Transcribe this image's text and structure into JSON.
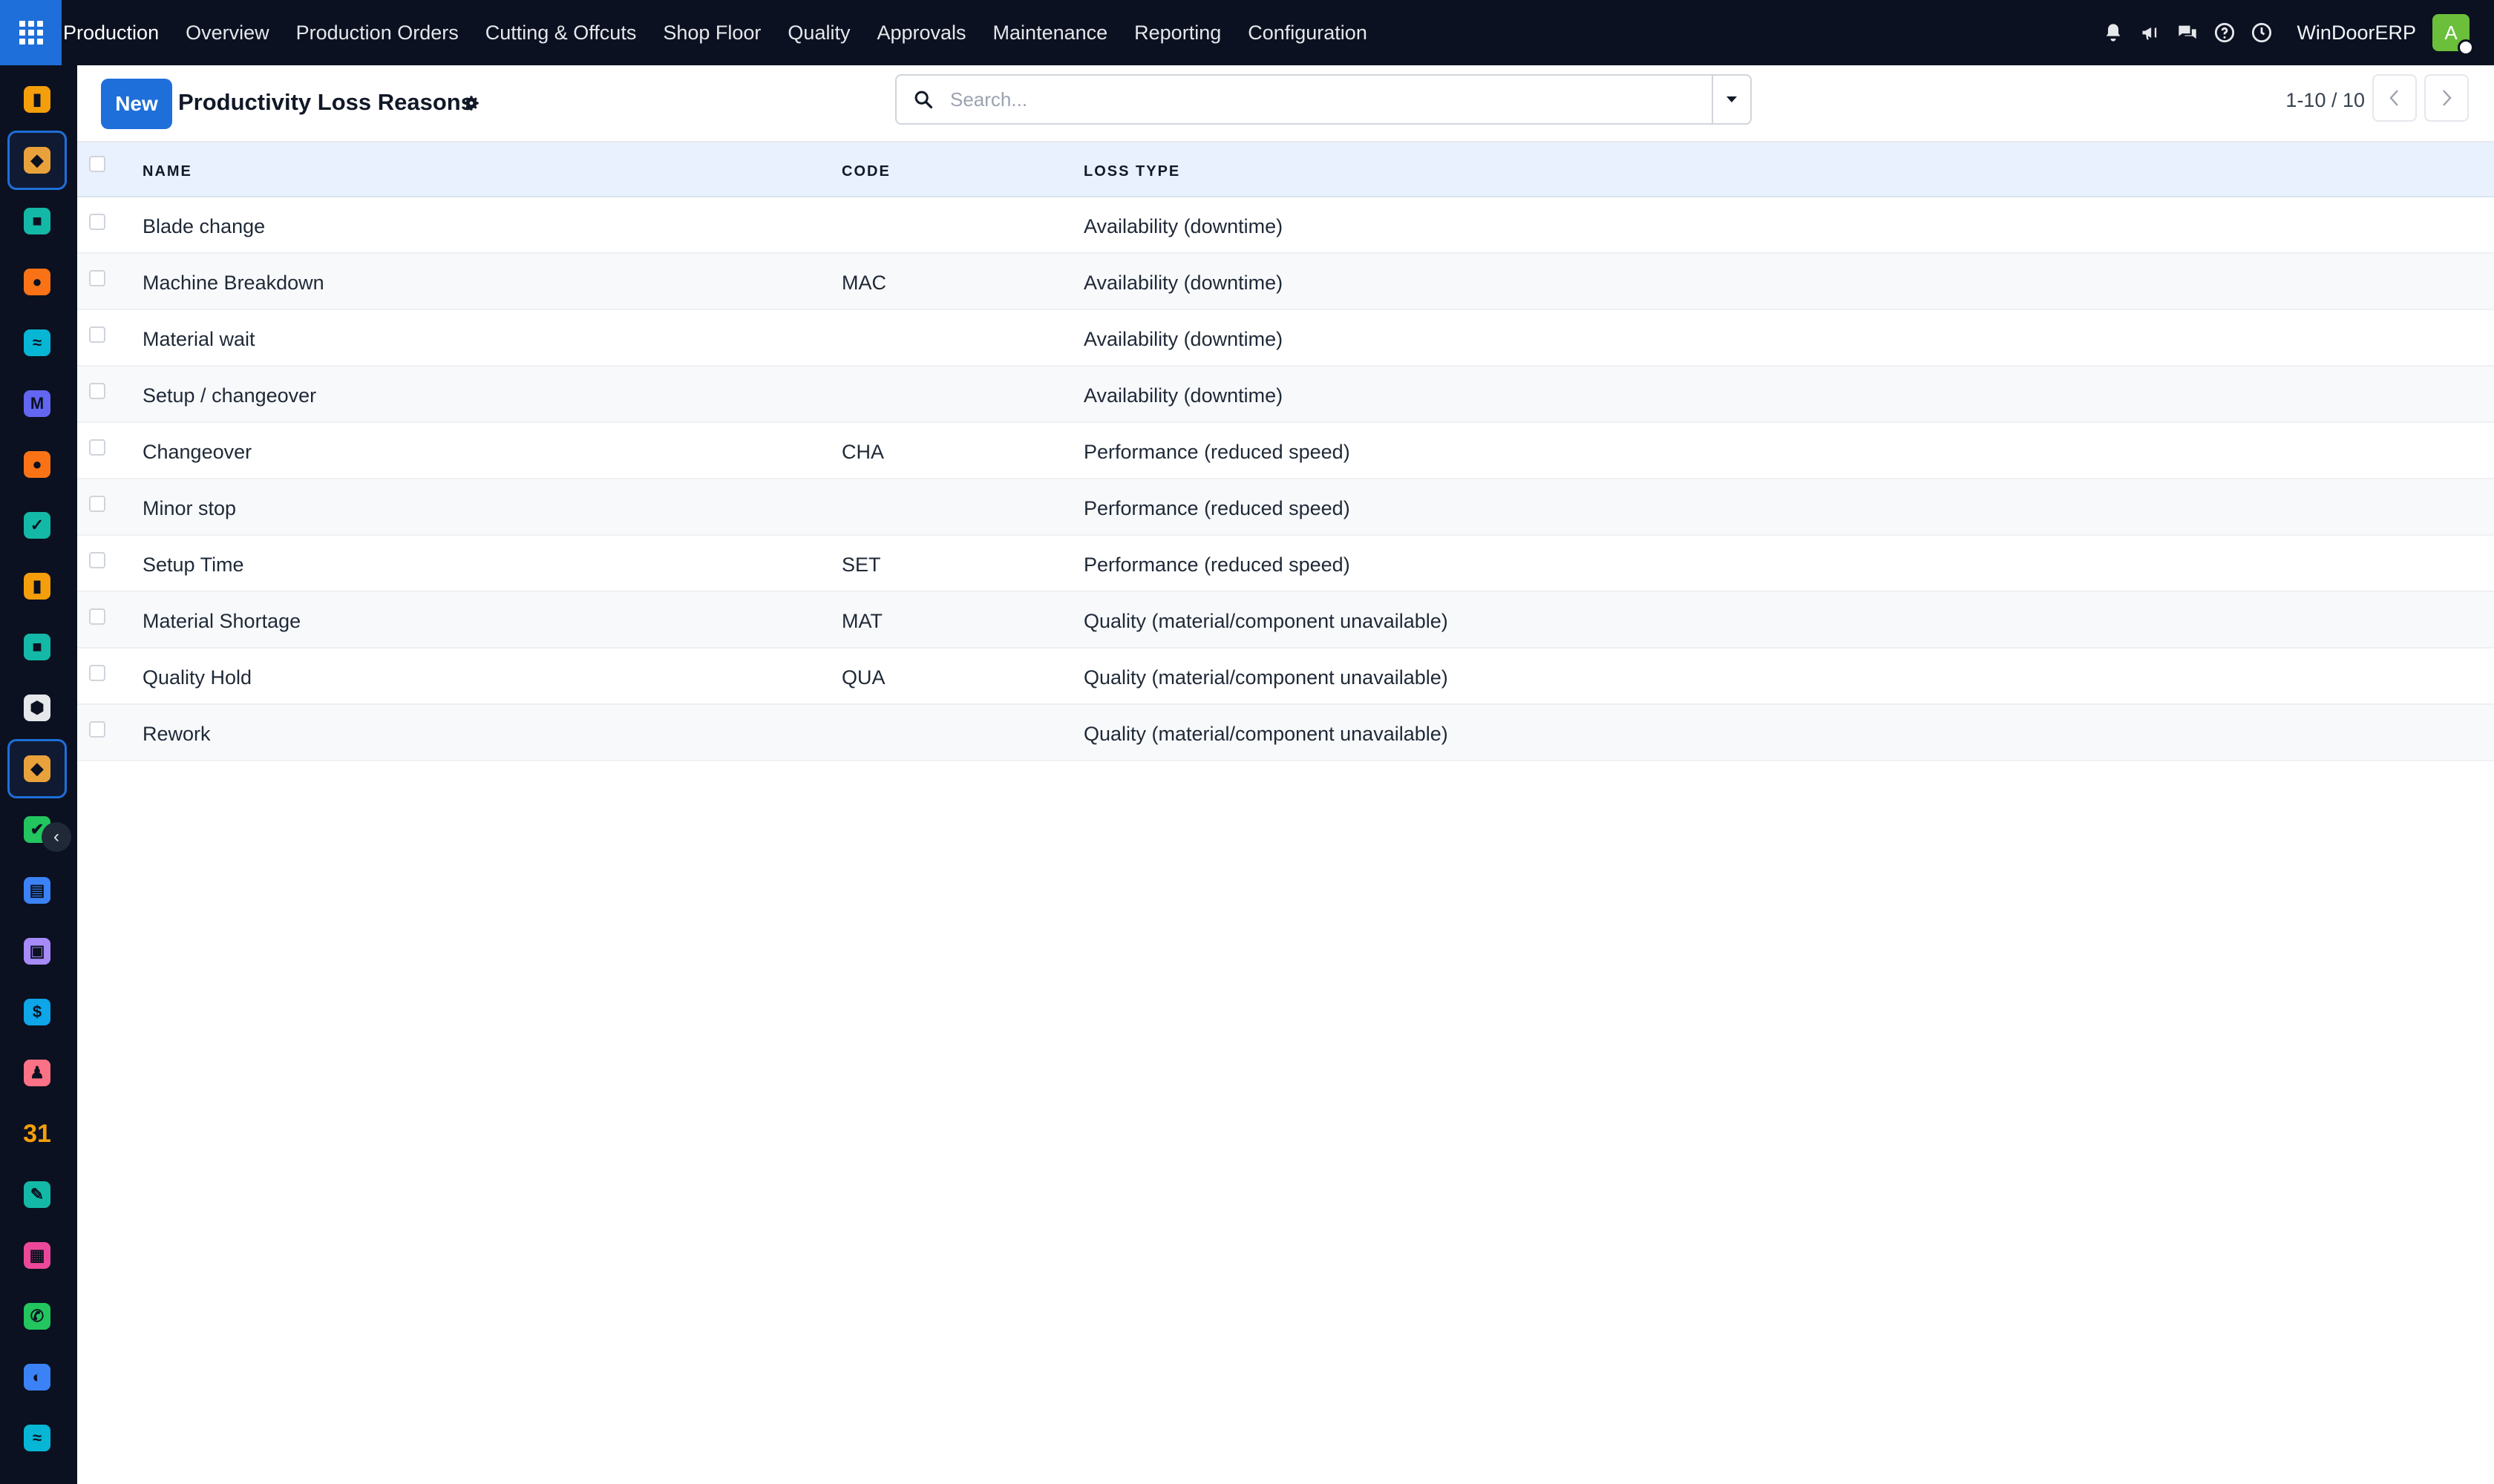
{
  "topbar": {
    "app_name": "Production",
    "menu": [
      "Overview",
      "Production Orders",
      "Cutting & Offcuts",
      "Shop Floor",
      "Quality",
      "Approvals",
      "Maintenance",
      "Reporting",
      "Configuration"
    ],
    "company": "WinDoorERP",
    "avatar_initial": "A",
    "icons": [
      "bell-icon",
      "megaphone-icon",
      "chat-icon",
      "help-icon",
      "clock-icon"
    ]
  },
  "sidebar": {
    "apps": [
      {
        "icon": "bar-chart-icon",
        "color": "#f59e0b"
      },
      {
        "icon": "manufacturing-app-icon",
        "color": "#e9a23b",
        "active": true
      },
      {
        "icon": "contacts-icon",
        "color": "#14b8a6"
      },
      {
        "icon": "discuss-icon",
        "color": "#f97316"
      },
      {
        "icon": "wave-app-icon",
        "color": "#06b6d4"
      },
      {
        "icon": "mail-app-icon",
        "color": "#6366f1"
      },
      {
        "icon": "chat-bubble-icon",
        "color": "#f97316"
      },
      {
        "icon": "check-app-icon",
        "color": "#14b8a6"
      },
      {
        "icon": "bar-chart-icon",
        "color": "#f59e0b"
      },
      {
        "icon": "contacts-icon",
        "color": "#14b8a6"
      },
      {
        "icon": "cube-icon",
        "color": "#e5e7eb"
      },
      {
        "icon": "manufacturing-app-icon",
        "color": "#e9a23b",
        "active": true
      },
      {
        "icon": "checkmark-app-icon",
        "color": "#22c55e"
      },
      {
        "icon": "knowledge-book-icon",
        "color": "#3b82f6"
      },
      {
        "icon": "inventory-box-icon",
        "color": "#a78bfa"
      },
      {
        "icon": "invoice-dollar-icon",
        "color": "#0ea5e9"
      },
      {
        "icon": "team-icon",
        "color": "#fb7185"
      },
      {
        "icon": "calendar-31-icon",
        "color": "#f59e0b",
        "text": "31"
      },
      {
        "icon": "sign-pen-icon",
        "color": "#14b8a6"
      },
      {
        "icon": "dashboard-icon",
        "color": "#ec4899"
      },
      {
        "icon": "whatsapp-icon",
        "color": "#22c55e"
      },
      {
        "icon": "compass-icon",
        "color": "#3b82f6"
      },
      {
        "icon": "wave-app-icon",
        "color": "#06b6d4"
      }
    ]
  },
  "control": {
    "new_label": "New",
    "title": "Productivity Loss Reasons",
    "search_placeholder": "Search...",
    "pager": "1-10 / 10"
  },
  "table": {
    "headers": {
      "name": "NAME",
      "code": "CODE",
      "loss_type": "LOSS TYPE"
    },
    "rows": [
      {
        "name": "Blade change",
        "code": "",
        "loss_type": "Availability (downtime)"
      },
      {
        "name": "Machine Breakdown",
        "code": "MAC",
        "loss_type": "Availability (downtime)"
      },
      {
        "name": "Material wait",
        "code": "",
        "loss_type": "Availability (downtime)"
      },
      {
        "name": "Setup / changeover",
        "code": "",
        "loss_type": "Availability (downtime)"
      },
      {
        "name": "Changeover",
        "code": "CHA",
        "loss_type": "Performance (reduced speed)"
      },
      {
        "name": "Minor stop",
        "code": "",
        "loss_type": "Performance (reduced speed)"
      },
      {
        "name": "Setup Time",
        "code": "SET",
        "loss_type": "Performance (reduced speed)"
      },
      {
        "name": "Material Shortage",
        "code": "MAT",
        "loss_type": "Quality (material/component unavailable)"
      },
      {
        "name": "Quality Hold",
        "code": "QUA",
        "loss_type": "Quality (material/component unavailable)"
      },
      {
        "name": "Rework",
        "code": "",
        "loss_type": "Quality (material/component unavailable)"
      }
    ]
  }
}
